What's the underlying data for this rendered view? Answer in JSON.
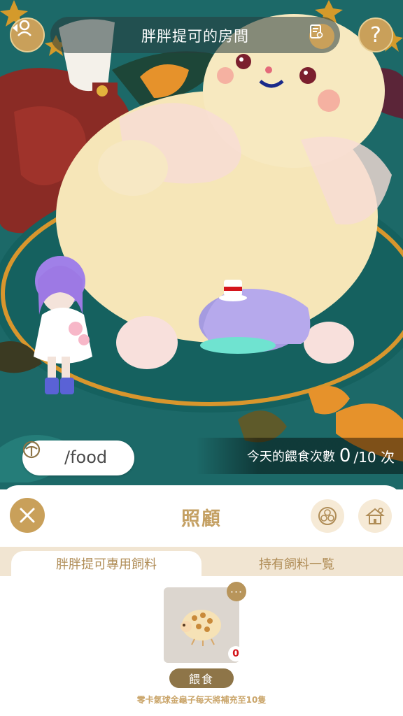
{
  "header": {
    "room_title": "胖胖提可的房間"
  },
  "command": {
    "text": "/food"
  },
  "feeding": {
    "label": "今天的餵食次數",
    "count": "0",
    "limit": "/10 次"
  },
  "panel": {
    "title": "照顧",
    "tabs": [
      {
        "label": "胖胖提可專用飼料",
        "active": true
      },
      {
        "label": "持有飼料一覧",
        "active": false
      }
    ],
    "food_item": {
      "quantity": "0",
      "more_label": "···",
      "feed_button": "餵食"
    },
    "refill_note": "零卡氣球金龜子每天將補充至10隻"
  },
  "icons": {
    "back": "exit-room-icon",
    "log": "log-icon",
    "help": "question-mark-icon",
    "command": "sprout-icon",
    "close": "close-icon",
    "rgb": "rgb-icon",
    "house": "house-icon"
  },
  "colors": {
    "accent_gold": "#c9a05a",
    "panel_title": "#c4a063",
    "tab_bar": "#f1e5d2",
    "feed_button": "#8e7548",
    "quantity_badge": "#d4151b"
  }
}
